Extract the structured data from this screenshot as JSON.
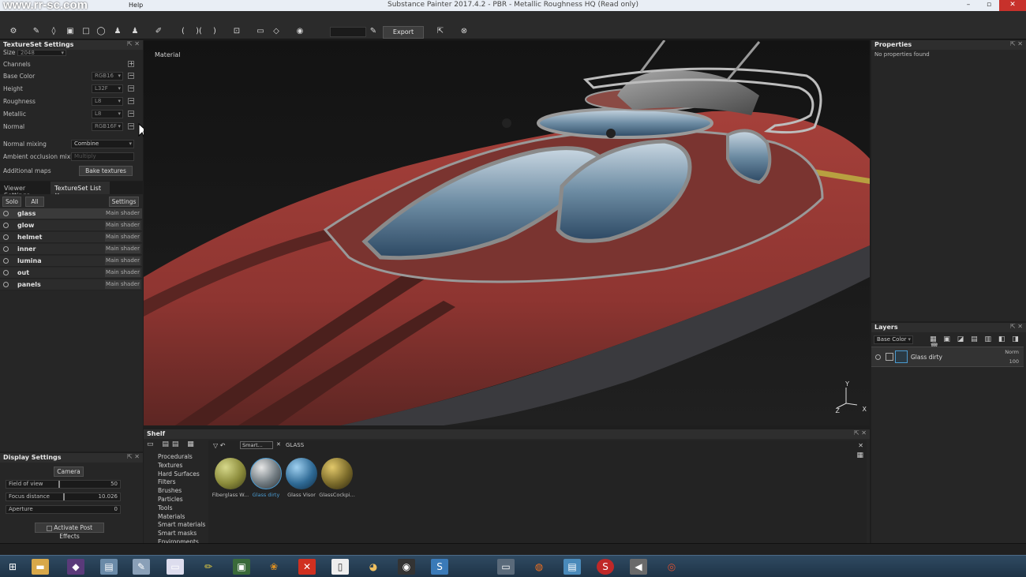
{
  "window": {
    "title": "Substance Painter 2017.4.2 - PBR - Metallic Roughness HQ (Read only)",
    "watermark": "www.rr-sc.com",
    "menu_help": "Help",
    "controls": [
      "–",
      "▫",
      "✕"
    ]
  },
  "toolbar": {
    "export_masks": "Export Masks",
    "icons": [
      "symmetry-icon",
      "paint-brush-icon",
      "eraser-icon",
      "projection-icon",
      "polygon-fill-icon",
      "smudge-icon",
      "clone-icon",
      "material-picker-icon",
      "color-picker-icon",
      "brush-settings-icon",
      "camera-icon",
      "viewport-mode-icon",
      "render-icon",
      "export-icon",
      "share-icon"
    ]
  },
  "textureset_settings": {
    "title": "TextureSet Settings",
    "size_label": "Size",
    "size_value": "2048",
    "channels_label": "Channels",
    "channels": [
      {
        "name": "Base Color",
        "format": "RGB16"
      },
      {
        "name": "Height",
        "format": "L32F"
      },
      {
        "name": "Roughness",
        "format": "L8"
      },
      {
        "name": "Metallic",
        "format": "L8"
      },
      {
        "name": "Normal",
        "format": "RGB16F"
      }
    ],
    "normal_mixing_label": "Normal mixing",
    "normal_mixing_value": "Combine",
    "ao_mixing_label": "Ambient occlusion mixing",
    "ao_mixing_value": "Multiply",
    "additional_maps_label": "Additional maps",
    "bake_button": "Bake textures"
  },
  "tabs": {
    "viewer_settings": "Viewer Settings",
    "textureset_list": "TextureSet List"
  },
  "textureset_list": {
    "solo": "Solo",
    "all": "All",
    "settings": "Settings",
    "items": [
      {
        "name": "glass",
        "shader": "Main shader"
      },
      {
        "name": "glow",
        "shader": "Main shader"
      },
      {
        "name": "helmet",
        "shader": "Main shader"
      },
      {
        "name": "inner",
        "shader": "Main shader"
      },
      {
        "name": "lumina",
        "shader": "Main shader"
      },
      {
        "name": "out",
        "shader": "Main shader"
      },
      {
        "name": "panels",
        "shader": "Main shader"
      }
    ]
  },
  "display_settings": {
    "title": "Display Settings",
    "camera_button": "Camera",
    "fov_label": "Field of view",
    "fov_value": "50",
    "focus_label": "Focus distance",
    "focus_value": "10.026",
    "aperture_label": "Aperture",
    "aperture_value": "0",
    "post_effects": "Activate Post Effects"
  },
  "viewport": {
    "label": "Material",
    "gizmo_x": "X",
    "gizmo_y": "Y",
    "gizmo_z": "Z"
  },
  "properties": {
    "title": "Properties",
    "empty_text": "No properties found"
  },
  "layers": {
    "title": "Layers",
    "channel": "Base Color",
    "layer_name": "Glass dirty",
    "blend": "Norm",
    "opacity": "100"
  },
  "shelf": {
    "title": "Shelf",
    "search_tag": "Smart...",
    "filter": "GLASS",
    "categories": [
      "Procedurals",
      "Textures",
      "Hard Surfaces",
      "Filters",
      "Brushes",
      "Particles",
      "Tools",
      "Materials",
      "Smart materials",
      "Smart masks",
      "Environments"
    ],
    "materials": [
      {
        "name": "Fiberglass W...",
        "color": "#8a8a3a"
      },
      {
        "name": "Glass dirty",
        "color": "#707a80"
      },
      {
        "name": "Glass Visor",
        "color": "#2f6a95"
      },
      {
        "name": "GlassCockpi...",
        "color": "#7a6a2a"
      }
    ]
  },
  "colors": {
    "hull_red": "#9e3a35",
    "accent_blue": "#4a9ad0",
    "taskbar": "#2b4459"
  }
}
